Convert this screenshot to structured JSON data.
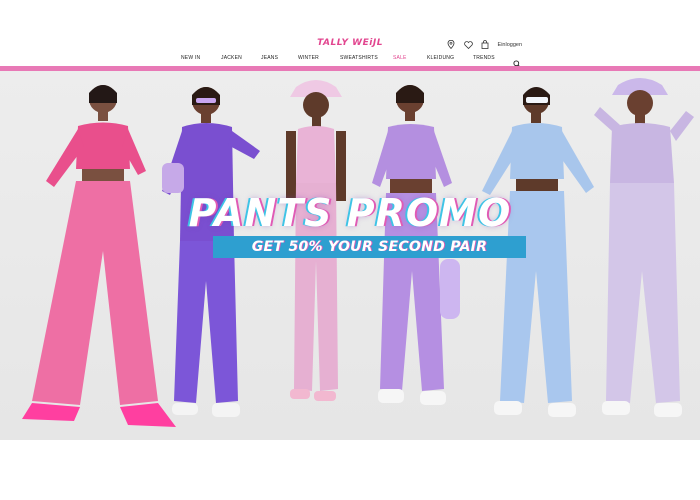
{
  "header": {
    "logo": "TALLY WEiJL",
    "login_label": "Einloggen",
    "icons": [
      "location-icon",
      "heart-icon",
      "bag-icon",
      "search-icon"
    ]
  },
  "nav": {
    "items": [
      {
        "label": "NEW IN"
      },
      {
        "label": "JACKEN"
      },
      {
        "label": "JEANS"
      },
      {
        "label": "WINTER"
      },
      {
        "label": "SWEATSHIRTS"
      },
      {
        "label": "SALE",
        "color": "#e2458f"
      },
      {
        "label": "KLEIDUNG"
      },
      {
        "label": "TRENDS"
      }
    ]
  },
  "colors": {
    "brand": "#e2458f",
    "pink_bar": "#e879b6",
    "promo_blue": "#2e9fd0"
  },
  "hero": {
    "headline": "PANTS PROMO",
    "subline": "GET 50% YOUR SECOND PAIR",
    "models": [
      {
        "name": "pink",
        "top": "#e94f8c",
        "pants": "#ee6fa4"
      },
      {
        "name": "violet",
        "top": "#7a4fd0",
        "pants": "#7c56d8"
      },
      {
        "name": "light-pink",
        "top": "#e9b3d6",
        "pants": "#e6b0d2"
      },
      {
        "name": "lavender",
        "top": "#b48fe0",
        "pants": "#b58fe2"
      },
      {
        "name": "light-blue",
        "top": "#a8c6ec",
        "pants": "#a9c7ee"
      },
      {
        "name": "lilac",
        "top": "#c8b6e2",
        "pants": "#d3c6e8"
      }
    ]
  }
}
